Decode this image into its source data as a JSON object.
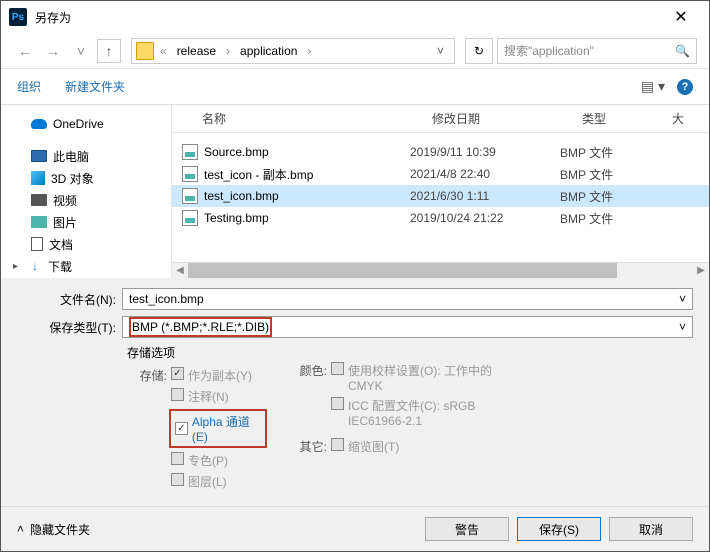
{
  "title": "另存为",
  "breadcrumb": {
    "sep": "«",
    "items": [
      "release",
      "application"
    ]
  },
  "search": {
    "placeholder": "搜索\"application\""
  },
  "toolbar": {
    "organize": "组织",
    "newfolder": "新建文件夹"
  },
  "sidebar": {
    "onedrive": "OneDrive",
    "thispc": "此电脑",
    "obj3d": "3D 对象",
    "video": "视频",
    "pictures": "图片",
    "documents": "文档",
    "downloads": "下载"
  },
  "columns": {
    "name": "名称",
    "date": "修改日期",
    "type": "类型",
    "size": "大"
  },
  "files": [
    {
      "name": "Source.bmp",
      "date": "2019/9/11 10:39",
      "type": "BMP 文件"
    },
    {
      "name": "test_icon - 副本.bmp",
      "date": "2021/4/8 22:40",
      "type": "BMP 文件"
    },
    {
      "name": "test_icon.bmp",
      "date": "2021/6/30 1:11",
      "type": "BMP 文件"
    },
    {
      "name": "Testing.bmp",
      "date": "2019/10/24 21:22",
      "type": "BMP 文件"
    }
  ],
  "form": {
    "filename_label": "文件名(N):",
    "filename_value": "test_icon.bmp",
    "filetype_label": "保存类型(T):",
    "filetype_value": "BMP (*.BMP;*.RLE;*.DIB)"
  },
  "save_options": {
    "title": "存储选项",
    "save_label": "存储:",
    "as_copy": "作为副本(Y)",
    "notes": "注释(N)",
    "alpha": "Alpha 通道(E)",
    "spot": "专色(P)",
    "layers": "图层(L)",
    "color_label": "颜色:",
    "proof": "使用校样设置(O): 工作中的 CMYK",
    "icc": "ICC 配置文件(C): sRGB IEC61966-2.1",
    "other_label": "其它:",
    "thumbnail": "缩览图(T)"
  },
  "footer": {
    "hide": "隐藏文件夹",
    "warn": "警告",
    "save": "保存(S)",
    "cancel": "取消"
  }
}
